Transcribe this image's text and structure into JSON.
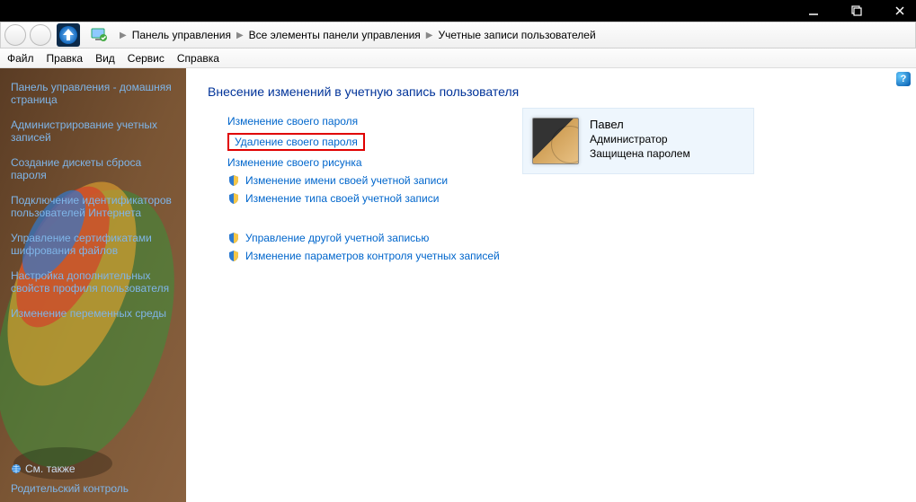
{
  "titlebar": {
    "min": "—",
    "max": "❐",
    "close": "✕"
  },
  "breadcrumb": {
    "items": [
      "Панель управления",
      "Все элементы панели управления",
      "Учетные записи пользователей"
    ]
  },
  "menubar": [
    "Файл",
    "Правка",
    "Вид",
    "Сервис",
    "Справка"
  ],
  "sidebar": {
    "links": [
      "Панель управления - домашняя страница",
      "Администрирование учетных записей",
      "Создание дискеты сброса пароля",
      "Подключение идентификаторов пользователей Интернета",
      "Управление сертификатами шифрования файлов",
      "Настройка дополнительных свойств профиля пользователя",
      "Изменение переменных среды"
    ],
    "seealso_label": "См. также",
    "seealso_link": "Родительский контроль"
  },
  "main": {
    "heading": "Внесение изменений в учетную запись пользователя",
    "actions_plain": [
      "Изменение своего пароля",
      "Удаление своего пароля",
      "Изменение своего рисунка"
    ],
    "actions_shield1": [
      "Изменение имени своей учетной записи",
      "Изменение типа своей учетной записи"
    ],
    "actions_shield2": [
      "Управление другой учетной записью",
      "Изменение параметров контроля учетных записей"
    ]
  },
  "user": {
    "name": "Павел",
    "role": "Администратор",
    "status": "Защищена паролем"
  },
  "help": "?"
}
